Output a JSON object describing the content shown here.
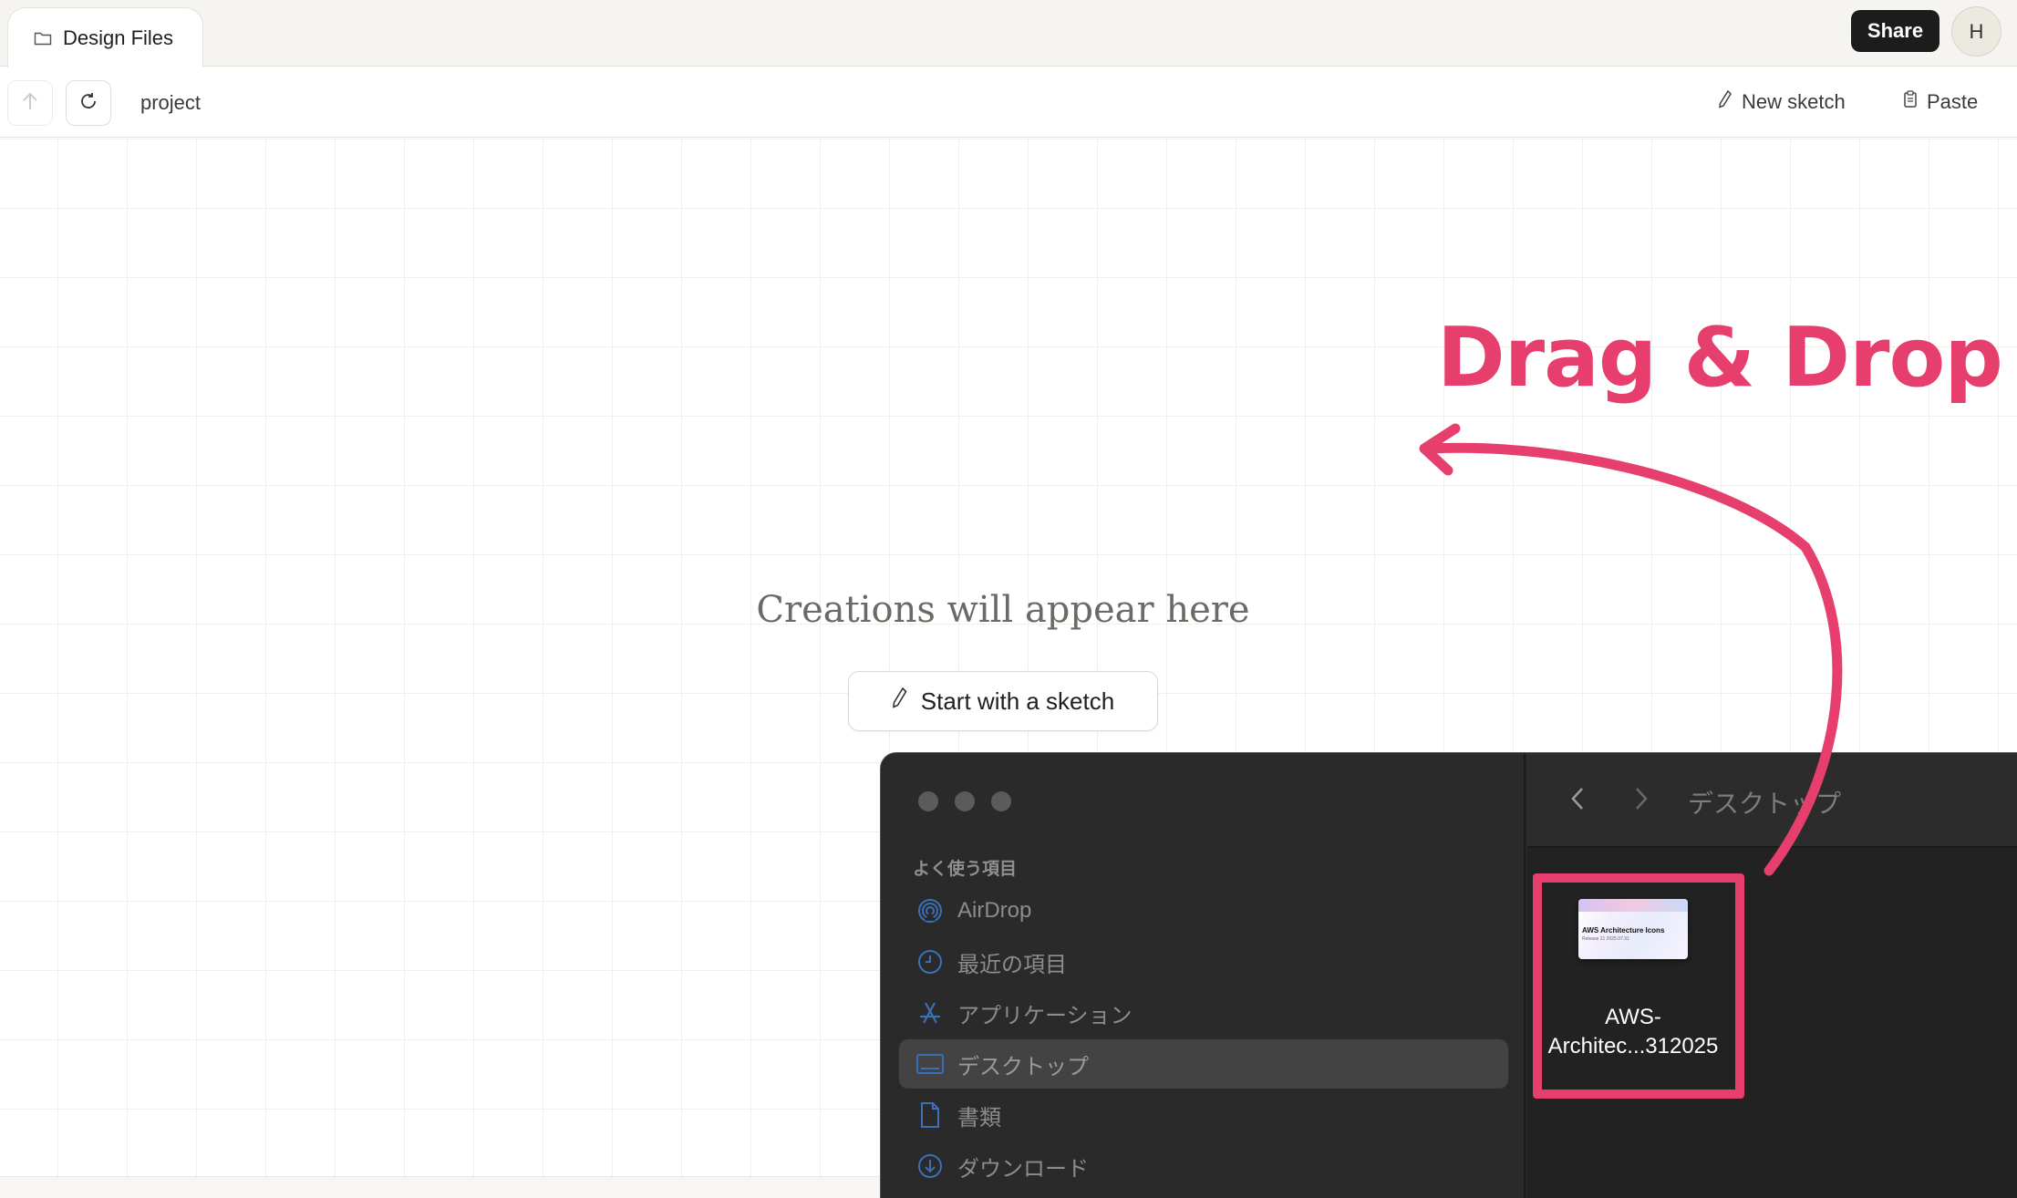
{
  "tab": {
    "label": "Design Files"
  },
  "header": {
    "share_label": "Share",
    "avatar_initial": "H"
  },
  "toolbar": {
    "breadcrumb": "project",
    "new_sketch_label": "New sketch",
    "paste_label": "Paste"
  },
  "canvas": {
    "empty_title": "Creations will appear here",
    "start_button_label": "Start with a sketch"
  },
  "annotation": {
    "text": "Drag & Drop",
    "color": "#e63f6e"
  },
  "finder": {
    "section_label": "よく使う項目",
    "sidebar": [
      {
        "label": "AirDrop",
        "icon": "airdrop-icon"
      },
      {
        "label": "最近の項目",
        "icon": "clock-icon"
      },
      {
        "label": "アプリケーション",
        "icon": "applications-icon"
      },
      {
        "label": "デスクトップ",
        "icon": "desktop-icon",
        "selected": true
      },
      {
        "label": "書類",
        "icon": "document-icon"
      },
      {
        "label": "ダウンロード",
        "icon": "download-icon"
      }
    ],
    "title": "デスクトップ",
    "file": {
      "name": "AWS-Architec...312025",
      "thumb_title": "AWS Architecture Icons",
      "thumb_subtitle": "Release 21 2025.07.31"
    }
  },
  "colors": {
    "accent": "#e63f6e",
    "finder_bg": "#282828",
    "share_bg": "#1c1c1c"
  }
}
